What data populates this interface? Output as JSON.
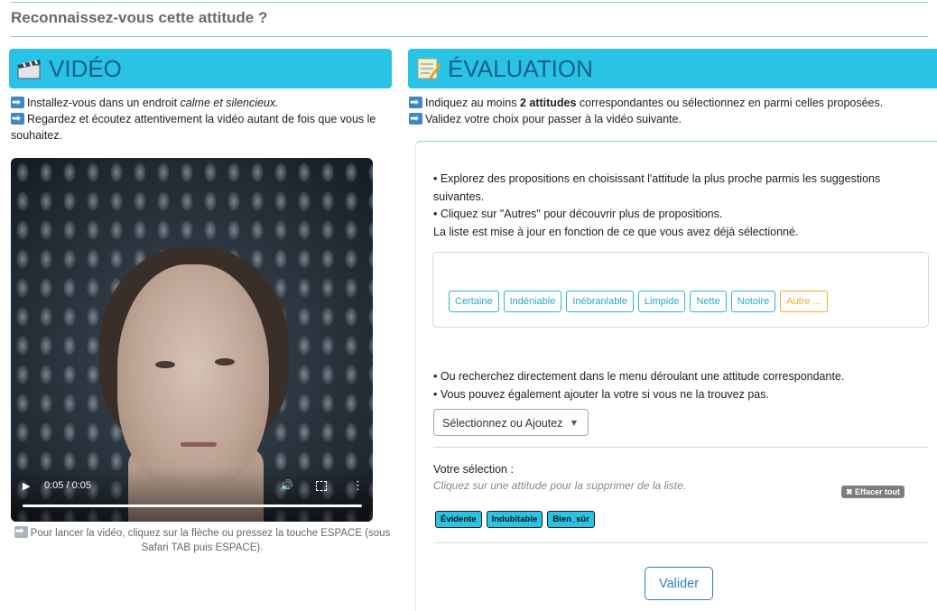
{
  "page": {
    "title": "Reconnaissez-vous cette attitude ?"
  },
  "video_panel": {
    "header": "VIDÉO",
    "header_icon": "clapperboard-icon",
    "instr1_pre": "Installez-vous dans un endroit ",
    "instr1_em": "calme et silencieux.",
    "instr2": "Regardez et écoutez attentivement la vidéo autant de fois que vous le souhaitez.",
    "player": {
      "time": "0:05 / 0:05",
      "progress": 1.0
    },
    "caption": "Pour lancer la vidéo, cliquez sur la flèche ou pressez la touche ESPACE (sous Safari TAB puis ESPACE)."
  },
  "eval_panel": {
    "header": "ÉVALUATION",
    "header_icon": "memo-icon",
    "instr1_pre": "Indiquez au moins ",
    "instr1_bold": "2 attitudes",
    "instr1_post": " correspondantes ou sélectionnez en parmi celles proposées.",
    "instr2": "Validez votre choix pour passer à la vidéo suivante.",
    "explore1": "• Explorez des propositions en choisissant l'attitude la plus proche parmis les suggestions suivantes.",
    "explore2": "• Cliquez sur \"Autres\" pour découvrir plus de propositions.",
    "explore3": "La liste est mise à jour en fonction de ce que vous avez déjà sélectionné.",
    "suggestions": [
      "Certaine",
      "Indéniable",
      "Inébranlable",
      "Limpide",
      "Nette",
      "Notoire"
    ],
    "other_label": "Autre ...",
    "search1": "• Ou recherchez directement dans le menu déroulant une attitude correspondante.",
    "search2": "• Vous pouvez également ajouter la votre si vous ne la trouvez pas.",
    "dropdown_label": "Sélectionnez ou Ajoutez",
    "selection_title": "Votre sélection :",
    "selection_hint": "Cliquez sur une attitude pour la supprimer de la liste.",
    "clear_label": "✖ Effacer tout",
    "selected": [
      "Évidente",
      "Indubitable",
      "Bien_sûr"
    ],
    "validate_label": "Valider"
  },
  "colors": {
    "accent": "#29c3e6",
    "header_text": "#15608a",
    "primary_button": "#2b7fc6",
    "other_chip": "#f0ad25"
  }
}
